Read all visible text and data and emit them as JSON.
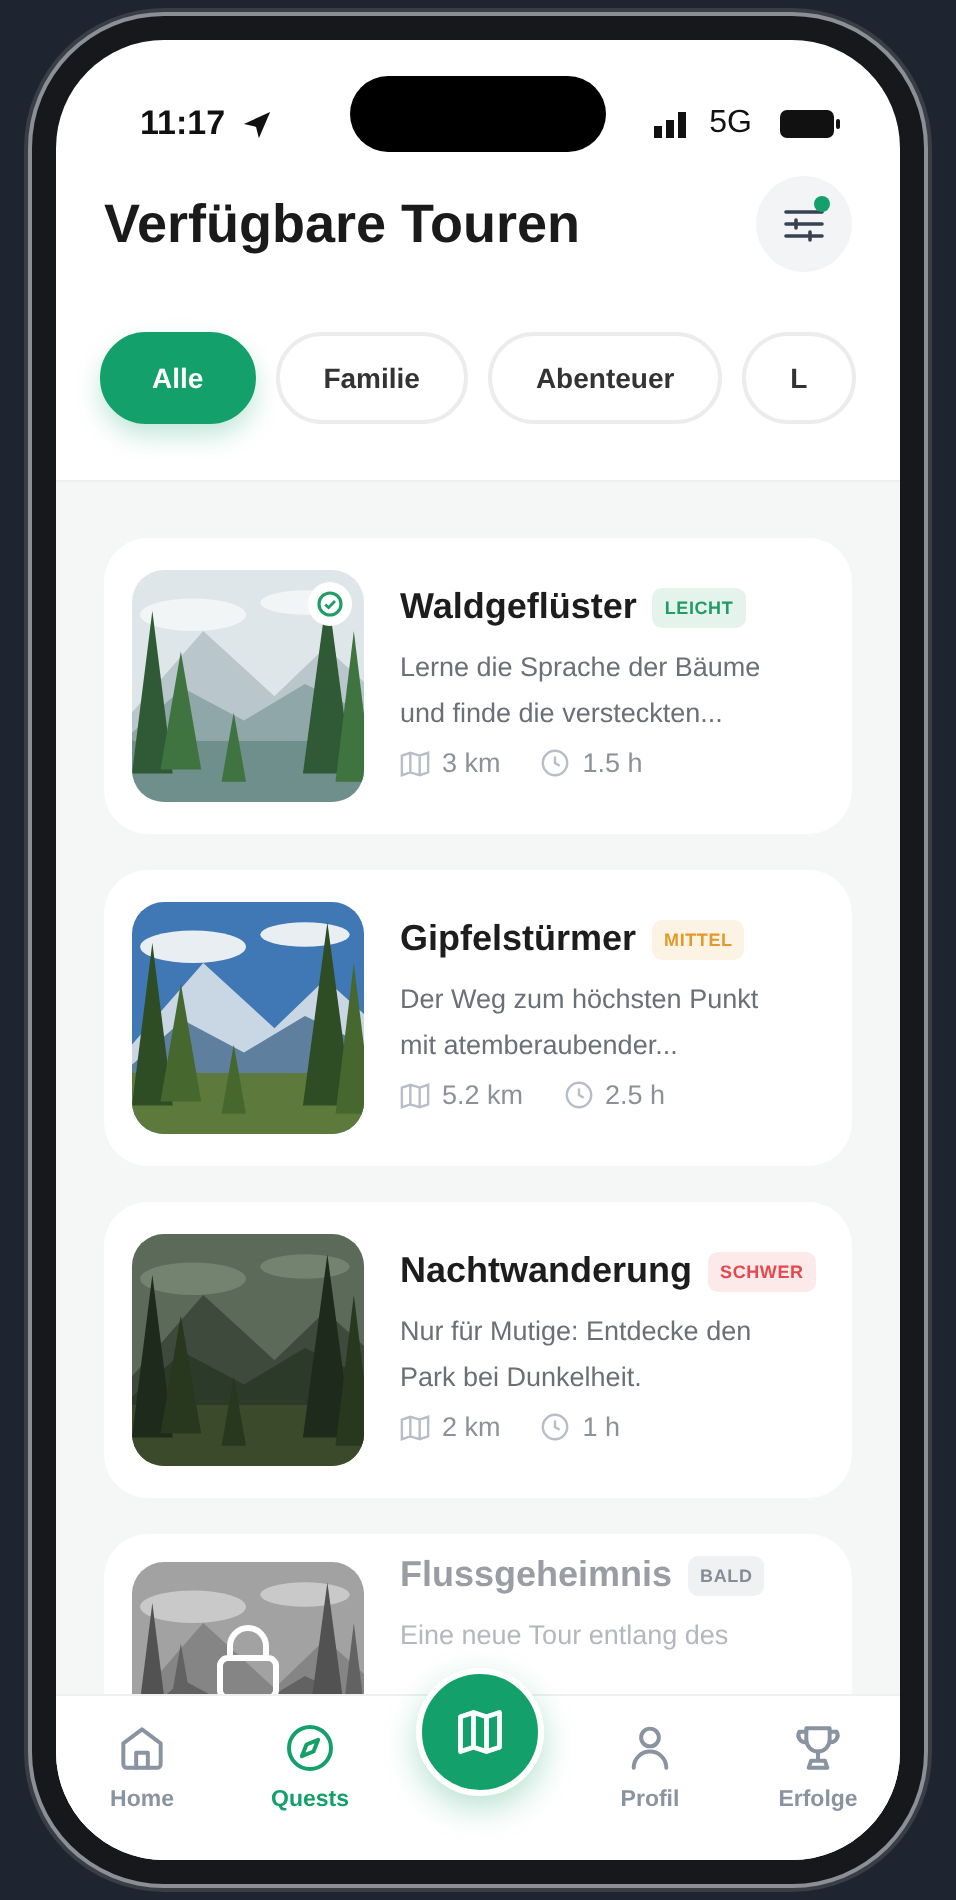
{
  "status_bar": {
    "time": "11:17",
    "network": "5G"
  },
  "header": {
    "title": "Verfügbare Touren",
    "filter_indicator": true
  },
  "filters": [
    {
      "label": "Alle",
      "selected": true
    },
    {
      "label": "Familie",
      "selected": false
    },
    {
      "label": "Abenteuer",
      "selected": false
    },
    {
      "label": "L",
      "selected": false
    }
  ],
  "tours": [
    {
      "title": "Waldgeflüster",
      "difficulty": "LEICHT",
      "color": "#1f9d63",
      "description_lines": [
        "Lerne die Sprache der Bäume",
        "und finde die versteckten..."
      ],
      "distance": "3 km",
      "duration": "1.5 h",
      "completed": true,
      "locked": false
    },
    {
      "title": "Gipfelstürmer",
      "difficulty": "MITTEL",
      "color": "#e39a2d",
      "description_lines": [
        "Der Weg zum höchsten Punkt",
        "mit atemberaubender..."
      ],
      "distance": "5.2 km",
      "duration": "2.5 h",
      "completed": false,
      "locked": false
    },
    {
      "title": "Nachtwanderung",
      "difficulty": "SCHWER",
      "color": "#e5484d",
      "description_lines": [
        "Nur für Mutige: Entdecke den",
        "Park bei Dunkelheit."
      ],
      "distance": "2 km",
      "duration": "1 h",
      "completed": false,
      "locked": false
    },
    {
      "title": "Flussgeheimnis",
      "difficulty": "BALD",
      "color": "#868d97",
      "description_lines": [
        "Eine neue Tour entlang des"
      ],
      "completed": false,
      "locked": true
    }
  ],
  "nav": [
    {
      "label": "Home",
      "selected": false
    },
    {
      "label": "Quests",
      "selected": true
    },
    {
      "kind": "fab",
      "selected": false
    },
    {
      "label": "Profil",
      "selected": false
    },
    {
      "label": "Erfolge",
      "selected": false
    }
  ]
}
